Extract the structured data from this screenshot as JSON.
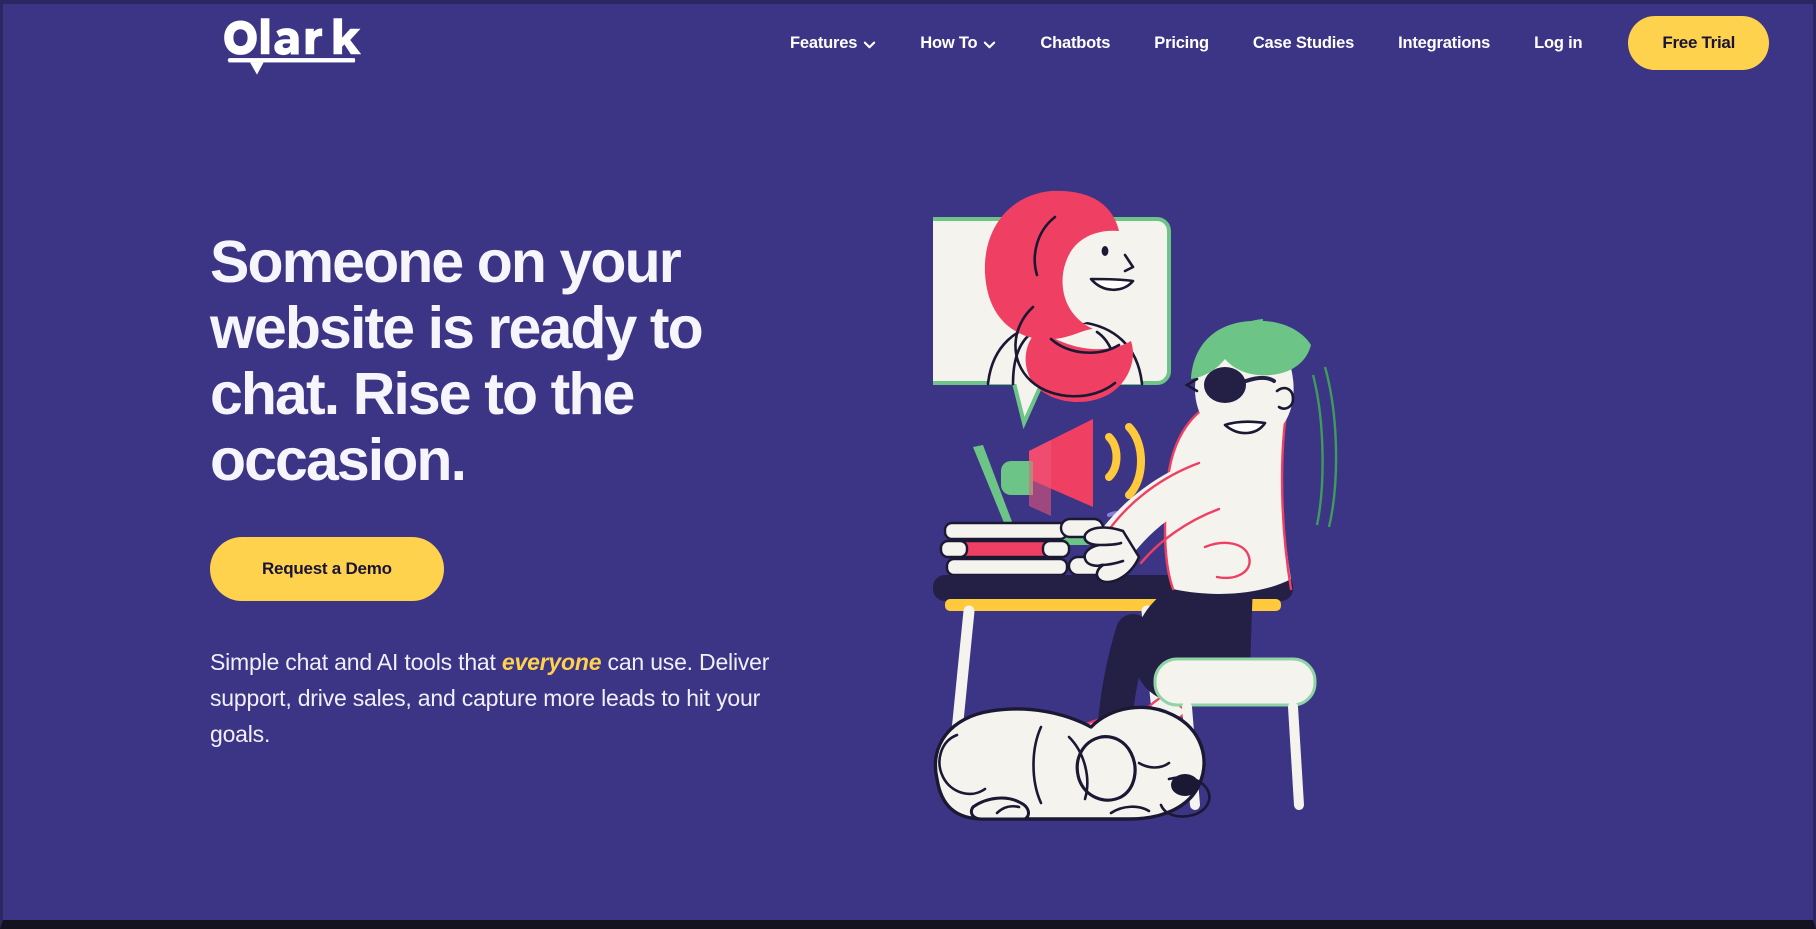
{
  "theme": {
    "background": "#3c3586",
    "accent_yellow": "#ffd24d",
    "text_light": "#f6f5fb",
    "dark_navy": "#191437",
    "illustration_green": "#6cc587",
    "illustration_pink": "#ef3f62",
    "illustration_cream": "#f4f3ee"
  },
  "brand": {
    "logo_text": "Olark",
    "logo_name": "olark-logo"
  },
  "nav": {
    "items": [
      {
        "label": "Features",
        "has_dropdown": true,
        "icon": "chevron-down-icon"
      },
      {
        "label": "How To",
        "has_dropdown": true,
        "icon": "chevron-down-icon"
      },
      {
        "label": "Chatbots",
        "has_dropdown": false
      },
      {
        "label": "Pricing",
        "has_dropdown": false
      },
      {
        "label": "Case Studies",
        "has_dropdown": false
      },
      {
        "label": "Integrations",
        "has_dropdown": false
      },
      {
        "label": "Log in",
        "has_dropdown": false
      }
    ],
    "cta_label": "Free Trial"
  },
  "hero": {
    "headline": "Someone on your website is ready to chat. Rise to the occasion.",
    "cta_label": "Request a Demo",
    "subtext_part1": "Simple chat and AI tools that ",
    "subtext_highlight": "everyone",
    "subtext_part2": " can use. Deliver support, drive sales, and capture more leads to hit your goals."
  },
  "illustration": {
    "name": "hero-illustration",
    "description": "Person with green hair seated at a desk with laptop, books and megaphone; speech bubble shows a smiling agent in a pink hijab; a white dog sleeps under the desk",
    "elements": [
      "speech-bubble-card",
      "agent-avatar-hijab",
      "megaphone-icon",
      "laptop",
      "book-stack",
      "desk",
      "seated-person",
      "chair",
      "sleeping-dog"
    ]
  }
}
